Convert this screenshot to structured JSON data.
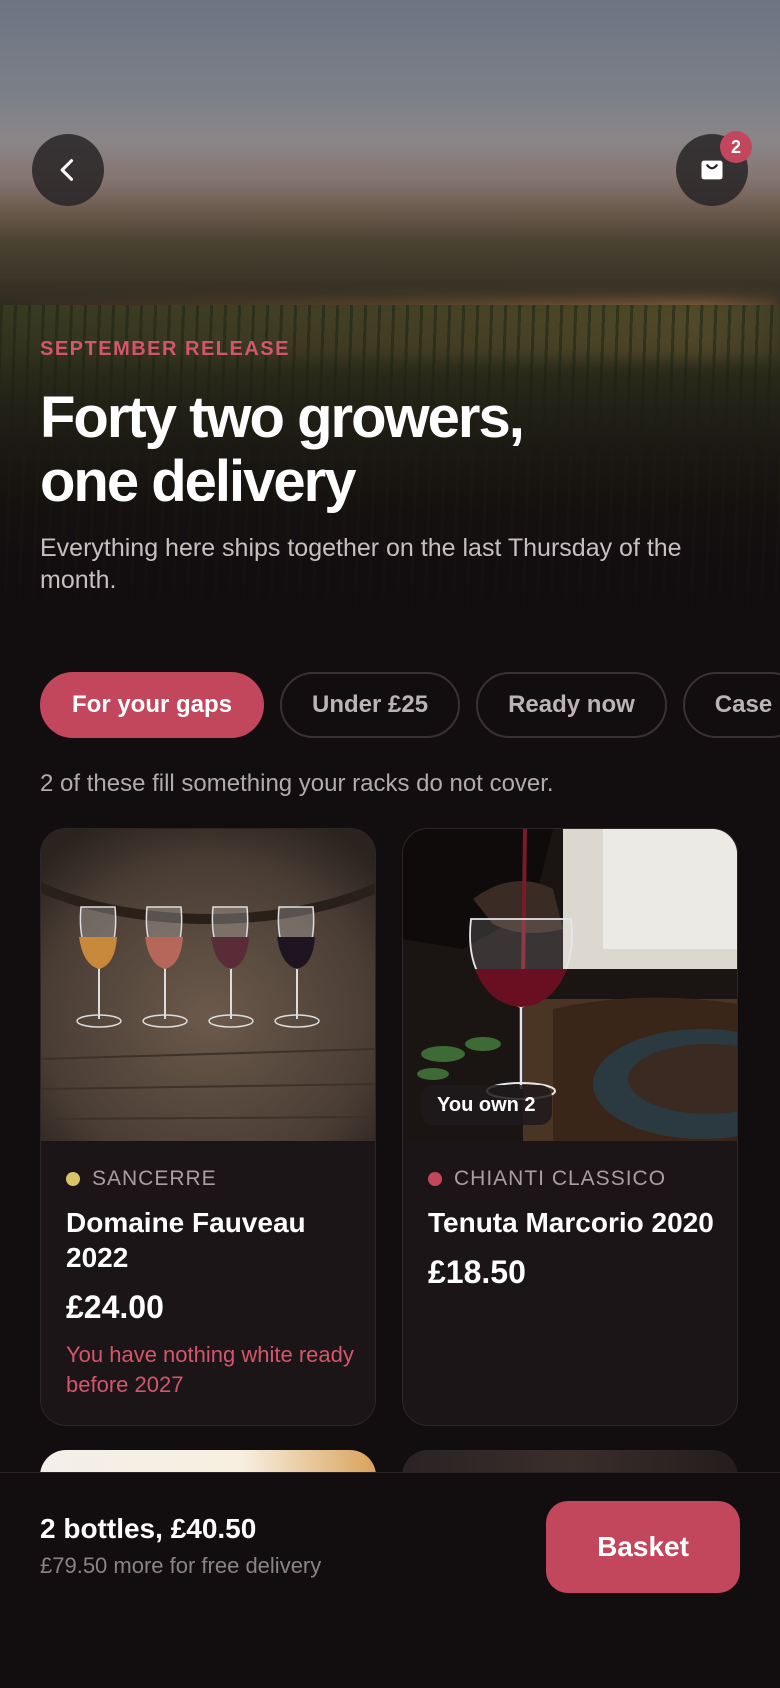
{
  "header": {
    "cart_count": "2"
  },
  "hero": {
    "eyebrow": "SEPTEMBER RELEASE",
    "title_line1": "Forty two growers,",
    "title_line2": "one delivery",
    "subtitle": "Everything here ships together on the last Thursday of the month."
  },
  "filters": [
    {
      "label": "For your gaps",
      "active": true
    },
    {
      "label": "Under £25",
      "active": false
    },
    {
      "label": "Ready now",
      "active": false
    },
    {
      "label": "Case",
      "active": false
    }
  ],
  "note": "2 of these fill something your racks do not cover.",
  "wines": [
    {
      "region": "SANCERRE",
      "dot_color": "#d9c46a",
      "name": "Domaine Fauveau 2022",
      "price": "£24.00",
      "gap_note": "You have nothing white ready before 2027"
    },
    {
      "region": "CHIANTI CLASSICO",
      "dot_color": "#c2475d",
      "name": "Tenuta Marcorio 2020",
      "price": "£18.50",
      "own_tag": "You own 2"
    }
  ],
  "footer": {
    "summary": "2 bottles, £40.50",
    "free_delivery": "£79.50 more for free delivery",
    "basket_label": "Basket"
  },
  "colors": {
    "accent": "#c2475d",
    "background": "#120d0f"
  }
}
